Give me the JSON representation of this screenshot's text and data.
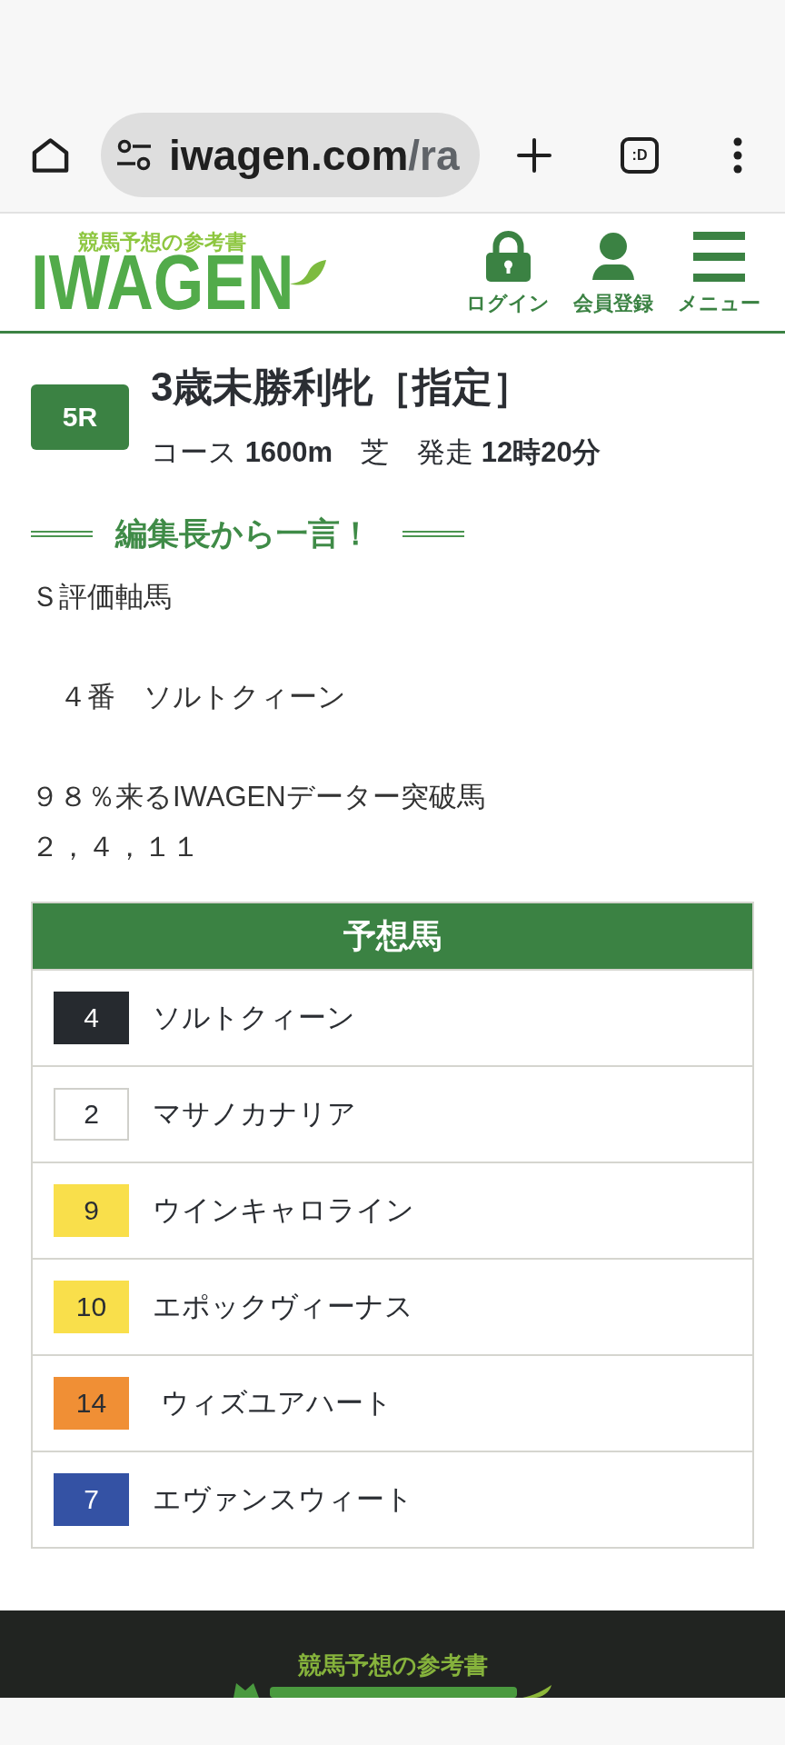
{
  "browser": {
    "url": {
      "host": "iwagen.com",
      "path": "/ra"
    },
    "tab_count": ":D"
  },
  "header": {
    "logo": {
      "tagline": "競馬予想の参考書",
      "wordmark": "IWAGEN"
    },
    "nav": [
      {
        "kind": "lock",
        "label": "ログイン"
      },
      {
        "kind": "person",
        "label": "会員登録"
      },
      {
        "kind": "menu",
        "label": "メニュー"
      }
    ]
  },
  "race": {
    "number": "5R",
    "title": "3歳未勝利牝［指定］",
    "info": "コース **1600m**　芝　発走 **12時20分**"
  },
  "comment": {
    "heading": "編集長から一言！",
    "paragraphs": [
      [
        "Ｓ評価軸馬"
      ],
      [
        "　４番　ソルトクィーン"
      ],
      [
        "９８％来るIWAGENデーター突破馬",
        "２，４，１１"
      ]
    ]
  },
  "picks": {
    "title": "予想馬",
    "horses": [
      {
        "number": "4",
        "name": "ソルトクィーン",
        "color": "#262a2f"
      },
      {
        "number": "2",
        "name": "マサノカナリア",
        "color": "#ffffff"
      },
      {
        "number": "9",
        "name": "ウインキャロライン",
        "color": "#f9df4b"
      },
      {
        "number": "10",
        "name": "エポックヴィーナス",
        "color": "#f9df4b"
      },
      {
        "number": "14",
        "name": " ウィズユアハート",
        "color": "#f08f35"
      },
      {
        "number": "7",
        "name": "エヴァンスウィート",
        "color": "#3452a4"
      }
    ]
  },
  "footer": {
    "tagline": "競馬予想の参考書"
  }
}
